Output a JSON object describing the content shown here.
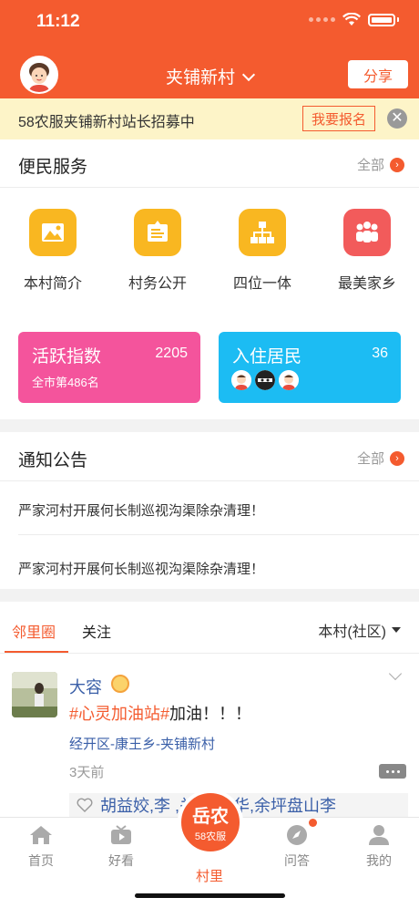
{
  "status": {
    "time": "11:12"
  },
  "header": {
    "village": "夹铺新村",
    "share_label": "分享"
  },
  "banner": {
    "text": "58农服夹铺新村站长招募中",
    "signup_label": "我要报名",
    "close_symbol": "✕"
  },
  "services": {
    "title": "便民服务",
    "more": "全部",
    "items": [
      {
        "label": "本村简介",
        "icon": "village-photo-icon",
        "color": "#f9b721"
      },
      {
        "label": "村务公开",
        "icon": "noticeboard-icon",
        "color": "#f9b721"
      },
      {
        "label": "四位一体",
        "icon": "org-chart-icon",
        "color": "#f9b721"
      },
      {
        "label": "最美家乡",
        "icon": "people-icon",
        "color": "#f25b5b"
      }
    ]
  },
  "stats": {
    "active": {
      "label": "活跃指数",
      "value": "2205",
      "rank": "全市第486名",
      "color": "#f4549c"
    },
    "residents": {
      "label": "入住居民",
      "value": "36",
      "color": "#1cbcf3"
    }
  },
  "notices": {
    "title": "通知公告",
    "more": "全部",
    "items": [
      "严家河村开展何长制巡视沟渠除杂清理！",
      "严家河村开展何长制巡视沟渠除杂清理！"
    ]
  },
  "feed": {
    "tabs": [
      "邻里圈",
      "关注"
    ],
    "region": "本村(社区)",
    "post": {
      "user": "大容",
      "tag": "#心灵加油站#",
      "text": "加油！！！",
      "location": "经开区-康王乡-夹铺新村",
      "time": "3天前",
      "likes": "胡益姣,李 ,关,谭兰华,余坪盘山李"
    }
  },
  "tabbar": {
    "items": [
      "首页",
      "好看",
      "问答",
      "我的"
    ],
    "center": {
      "big": "岳农",
      "small": "58农服",
      "label": "村里"
    }
  },
  "colors": {
    "brand": "#f45b2f",
    "banner_bg": "#fdf4c8"
  }
}
